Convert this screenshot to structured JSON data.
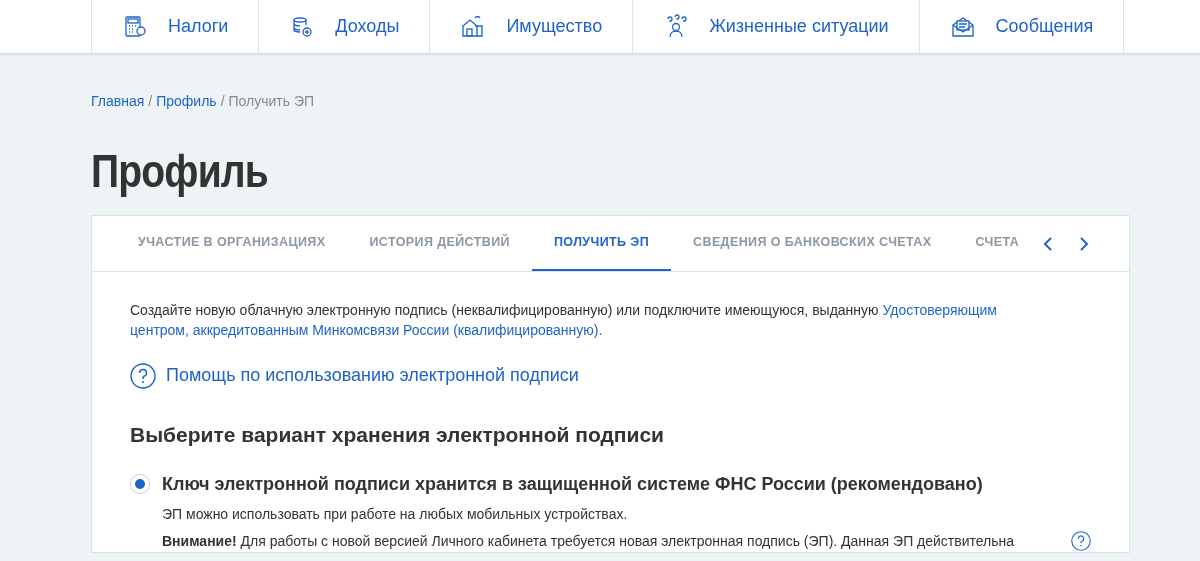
{
  "nav": [
    {
      "label": "Налоги",
      "kind": "calculator"
    },
    {
      "label": "Доходы",
      "kind": "coins"
    },
    {
      "label": "Имущество",
      "kind": "house"
    },
    {
      "label": "Жизненные ситуации",
      "kind": "person"
    },
    {
      "label": "Сообщения",
      "kind": "mail"
    }
  ],
  "breadcrumb": [
    {
      "label": "Главная",
      "kind": "link"
    },
    {
      "label": "/",
      "kind": "separator"
    },
    {
      "label": "Профиль",
      "kind": "link"
    },
    {
      "label": "/",
      "kind": "separator"
    },
    {
      "label": "Получить ЭП",
      "kind": "current"
    }
  ],
  "page_title": "Профиль",
  "tabs": [
    {
      "label": "УЧАСТИЕ В ОРГАНИЗАЦИЯХ",
      "selected": false
    },
    {
      "label": "ИСТОРИЯ ДЕЙСТВИЙ",
      "selected": false
    },
    {
      "label": "ПОЛУЧИТЬ ЭП",
      "selected": true
    },
    {
      "label": "СВЕДЕНИЯ О БАНКОВСКИХ СЧЕТАХ",
      "selected": false
    },
    {
      "label": "СЧЕТА",
      "selected": false
    }
  ],
  "intro": {
    "lines": [
      [
        {
          "text": "Создайте новую облачную электронную подпись (неквалифицированную) или подключите имеющуюся, выданную ",
          "kind": "text"
        },
        {
          "text": "Удостоверяющим",
          "kind": "link"
        }
      ],
      [
        {
          "text": "центром, аккредитованным Минкомсвязи России (квалифицированную).",
          "kind": "link"
        }
      ]
    ]
  },
  "help_link": "Помощь по использованию электронной подписи",
  "section_title": "Выберите вариант хранения электронной подписи",
  "options": [
    {
      "label": "Ключ электронной подписи хранится в защищенной системе ФНС России (рекомендовано)",
      "selected": true,
      "description": "ЭП можно использовать при работе на любых мобильных устройствах.",
      "note": "**Внимание!** Для работы с новой версией Личного кабинета требуется новая электронная подпись (ЭП). Данная ЭП  действительна"
    }
  ]
}
